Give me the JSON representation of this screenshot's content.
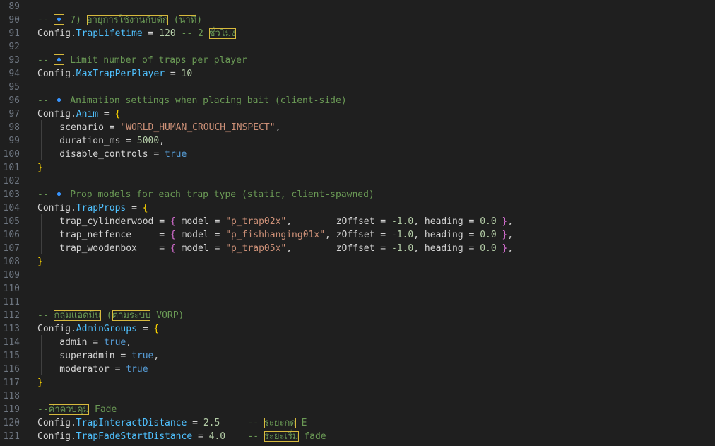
{
  "editor": {
    "lines": [
      {
        "n": "89",
        "tokens": []
      },
      {
        "n": "90",
        "tokens": [
          {
            "t": "-- ",
            "c": "comment"
          },
          {
            "t": "",
            "c": "diamond"
          },
          {
            "t": " 7) ",
            "c": "comment"
          },
          {
            "t": "อายุการใช้งานกับดัก",
            "c": "comment",
            "hl": true
          },
          {
            "t": " (",
            "c": "comment"
          },
          {
            "t": "นาที",
            "c": "comment",
            "hl": true
          },
          {
            "t": ")",
            "c": "comment"
          }
        ]
      },
      {
        "n": "91",
        "tokens": [
          {
            "t": "Config",
            "c": "plain"
          },
          {
            "t": ".",
            "c": "plain"
          },
          {
            "t": "TrapLifetime",
            "c": "field"
          },
          {
            "t": " = ",
            "c": "plain"
          },
          {
            "t": "120",
            "c": "num"
          },
          {
            "t": " -- 2 ",
            "c": "comment"
          },
          {
            "t": "ชั่วโมง",
            "c": "comment",
            "hl": true
          }
        ]
      },
      {
        "n": "92",
        "tokens": []
      },
      {
        "n": "93",
        "tokens": [
          {
            "t": "-- ",
            "c": "comment"
          },
          {
            "t": "",
            "c": "diamond"
          },
          {
            "t": " Limit number of traps per player",
            "c": "comment"
          }
        ]
      },
      {
        "n": "94",
        "tokens": [
          {
            "t": "Config",
            "c": "plain"
          },
          {
            "t": ".",
            "c": "plain"
          },
          {
            "t": "MaxTrapPerPlayer",
            "c": "field"
          },
          {
            "t": " = ",
            "c": "plain"
          },
          {
            "t": "10",
            "c": "num"
          }
        ]
      },
      {
        "n": "95",
        "tokens": []
      },
      {
        "n": "96",
        "tokens": [
          {
            "t": "-- ",
            "c": "comment"
          },
          {
            "t": "",
            "c": "diamond"
          },
          {
            "t": " Animation settings when placing bait (client-side)",
            "c": "comment"
          }
        ]
      },
      {
        "n": "97",
        "tokens": [
          {
            "t": "Config",
            "c": "plain"
          },
          {
            "t": ".",
            "c": "plain"
          },
          {
            "t": "Anim",
            "c": "field"
          },
          {
            "t": " = ",
            "c": "plain"
          },
          {
            "t": "{",
            "c": "brace"
          }
        ]
      },
      {
        "n": "98",
        "tokens": [
          {
            "t": "    scenario",
            "c": "plain"
          },
          {
            "t": " = ",
            "c": "plain"
          },
          {
            "t": "\"WORLD_HUMAN_CROUCH_INSPECT\"",
            "c": "str"
          },
          {
            "t": ",",
            "c": "plain"
          }
        ]
      },
      {
        "n": "99",
        "tokens": [
          {
            "t": "    duration_ms",
            "c": "plain"
          },
          {
            "t": " = ",
            "c": "plain"
          },
          {
            "t": "5000",
            "c": "num"
          },
          {
            "t": ",",
            "c": "plain"
          }
        ]
      },
      {
        "n": "100",
        "tokens": [
          {
            "t": "    disable_controls",
            "c": "plain"
          },
          {
            "t": " = ",
            "c": "plain"
          },
          {
            "t": "true",
            "c": "kw"
          }
        ]
      },
      {
        "n": "101",
        "tokens": [
          {
            "t": "}",
            "c": "brace"
          }
        ]
      },
      {
        "n": "102",
        "tokens": []
      },
      {
        "n": "103",
        "tokens": [
          {
            "t": "-- ",
            "c": "comment"
          },
          {
            "t": "",
            "c": "diamond"
          },
          {
            "t": " Prop models for each trap type (static, client-spawned)",
            "c": "comment"
          }
        ]
      },
      {
        "n": "104",
        "tokens": [
          {
            "t": "Config",
            "c": "plain"
          },
          {
            "t": ".",
            "c": "plain"
          },
          {
            "t": "TrapProps",
            "c": "field"
          },
          {
            "t": " = ",
            "c": "plain"
          },
          {
            "t": "{",
            "c": "brace"
          }
        ]
      },
      {
        "n": "105",
        "tokens": [
          {
            "t": "    trap_cylinderwood",
            "c": "plain"
          },
          {
            "t": " = ",
            "c": "plain"
          },
          {
            "t": "{",
            "c": "brace2"
          },
          {
            "t": " model = ",
            "c": "plain"
          },
          {
            "t": "\"p_trap02x\"",
            "c": "str"
          },
          {
            "t": ",        zOffset = ",
            "c": "plain"
          },
          {
            "t": "-1.0",
            "c": "num"
          },
          {
            "t": ", heading = ",
            "c": "plain"
          },
          {
            "t": "0.0",
            "c": "num"
          },
          {
            "t": " ",
            "c": "plain"
          },
          {
            "t": "}",
            "c": "brace2"
          },
          {
            "t": ",",
            "c": "plain"
          }
        ]
      },
      {
        "n": "106",
        "tokens": [
          {
            "t": "    trap_netfence",
            "c": "plain"
          },
          {
            "t": "     = ",
            "c": "plain"
          },
          {
            "t": "{",
            "c": "brace2"
          },
          {
            "t": " model = ",
            "c": "plain"
          },
          {
            "t": "\"p_fishhanging01x\"",
            "c": "str"
          },
          {
            "t": ", zOffset = ",
            "c": "plain"
          },
          {
            "t": "-1.0",
            "c": "num"
          },
          {
            "t": ", heading = ",
            "c": "plain"
          },
          {
            "t": "0.0",
            "c": "num"
          },
          {
            "t": " ",
            "c": "plain"
          },
          {
            "t": "}",
            "c": "brace2"
          },
          {
            "t": ",",
            "c": "plain"
          }
        ]
      },
      {
        "n": "107",
        "tokens": [
          {
            "t": "    trap_woodenbox",
            "c": "plain"
          },
          {
            "t": "    = ",
            "c": "plain"
          },
          {
            "t": "{",
            "c": "brace2"
          },
          {
            "t": " model = ",
            "c": "plain"
          },
          {
            "t": "\"p_trap05x\"",
            "c": "str"
          },
          {
            "t": ",        zOffset = ",
            "c": "plain"
          },
          {
            "t": "-1.0",
            "c": "num"
          },
          {
            "t": ", heading = ",
            "c": "plain"
          },
          {
            "t": "0.0",
            "c": "num"
          },
          {
            "t": " ",
            "c": "plain"
          },
          {
            "t": "}",
            "c": "brace2"
          },
          {
            "t": ",",
            "c": "plain"
          }
        ]
      },
      {
        "n": "108",
        "tokens": [
          {
            "t": "}",
            "c": "brace"
          }
        ]
      },
      {
        "n": "109",
        "tokens": []
      },
      {
        "n": "110",
        "tokens": []
      },
      {
        "n": "111",
        "tokens": []
      },
      {
        "n": "112",
        "tokens": [
          {
            "t": "-- ",
            "c": "comment"
          },
          {
            "t": "กลุ่มแอดมิน",
            "c": "comment",
            "hl": true
          },
          {
            "t": " (",
            "c": "comment"
          },
          {
            "t": "ตามระบบ",
            "c": "comment",
            "hl": true
          },
          {
            "t": " VORP)",
            "c": "comment"
          }
        ]
      },
      {
        "n": "113",
        "tokens": [
          {
            "t": "Config",
            "c": "plain"
          },
          {
            "t": ".",
            "c": "plain"
          },
          {
            "t": "AdminGroups",
            "c": "field"
          },
          {
            "t": " = ",
            "c": "plain"
          },
          {
            "t": "{",
            "c": "brace"
          }
        ]
      },
      {
        "n": "114",
        "tokens": [
          {
            "t": "    admin",
            "c": "plain"
          },
          {
            "t": " = ",
            "c": "plain"
          },
          {
            "t": "true",
            "c": "kw"
          },
          {
            "t": ",",
            "c": "plain"
          }
        ]
      },
      {
        "n": "115",
        "tokens": [
          {
            "t": "    superadmin",
            "c": "plain"
          },
          {
            "t": " = ",
            "c": "plain"
          },
          {
            "t": "true",
            "c": "kw"
          },
          {
            "t": ",",
            "c": "plain"
          }
        ]
      },
      {
        "n": "116",
        "tokens": [
          {
            "t": "    moderator",
            "c": "plain"
          },
          {
            "t": " = ",
            "c": "plain"
          },
          {
            "t": "true",
            "c": "kw"
          }
        ]
      },
      {
        "n": "117",
        "tokens": [
          {
            "t": "}",
            "c": "brace"
          }
        ]
      },
      {
        "n": "118",
        "tokens": []
      },
      {
        "n": "119",
        "tokens": [
          {
            "t": "--",
            "c": "comment"
          },
          {
            "t": "ค่าควบคุม",
            "c": "comment",
            "hl": true
          },
          {
            "t": " Fade",
            "c": "comment"
          }
        ]
      },
      {
        "n": "120",
        "tokens": [
          {
            "t": "Config",
            "c": "plain"
          },
          {
            "t": ".",
            "c": "plain"
          },
          {
            "t": "TrapInteractDistance",
            "c": "field"
          },
          {
            "t": " = ",
            "c": "plain"
          },
          {
            "t": "2.5",
            "c": "num"
          },
          {
            "t": "     -- ",
            "c": "comment"
          },
          {
            "t": "ระยะกด",
            "c": "comment",
            "hl": true
          },
          {
            "t": " E",
            "c": "comment"
          }
        ]
      },
      {
        "n": "121",
        "tokens": [
          {
            "t": "Config",
            "c": "plain"
          },
          {
            "t": ".",
            "c": "plain"
          },
          {
            "t": "TrapFadeStartDistance",
            "c": "field"
          },
          {
            "t": " = ",
            "c": "plain"
          },
          {
            "t": "4.0",
            "c": "num"
          },
          {
            "t": "    -- ",
            "c": "comment"
          },
          {
            "t": "ระยะเริ่ม",
            "c": "comment",
            "hl": true
          },
          {
            "t": " fade",
            "c": "comment"
          }
        ]
      }
    ]
  }
}
